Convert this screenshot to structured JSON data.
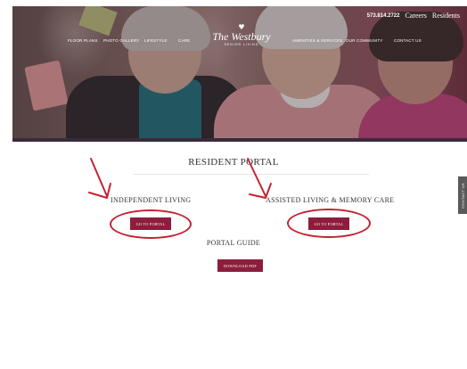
{
  "header": {
    "phone": "573.814.2722",
    "careers_label": "Careers",
    "residents_label": "Residents",
    "logo": {
      "name": "The Westbury",
      "tagline": "SENIOR LIVING"
    },
    "nav": [
      "FLOOR PLANS",
      "PHOTO GALLERY",
      "LIFESTYLE",
      "CARE",
      "AMENITIES & SERVICES",
      "OUR COMMUNITY",
      "CONTACT US"
    ]
  },
  "page": {
    "title": "RESIDENT PORTAL",
    "sections": [
      {
        "title": "INDEPENDENT LIVING",
        "button_label": "GO TO PORTAL"
      },
      {
        "title": "ASSISTED LIVING & MEMORY CARE",
        "button_label": "GO TO PORTAL"
      }
    ],
    "guide_title": "PORTAL GUIDE",
    "download_label": "DOWNLOAD PDF"
  },
  "side_tab": {
    "label": "CONTACT US"
  },
  "colors": {
    "button": "#8c1d3c",
    "annotation": "#c42333",
    "hero_bar": "#3a2a3e"
  }
}
